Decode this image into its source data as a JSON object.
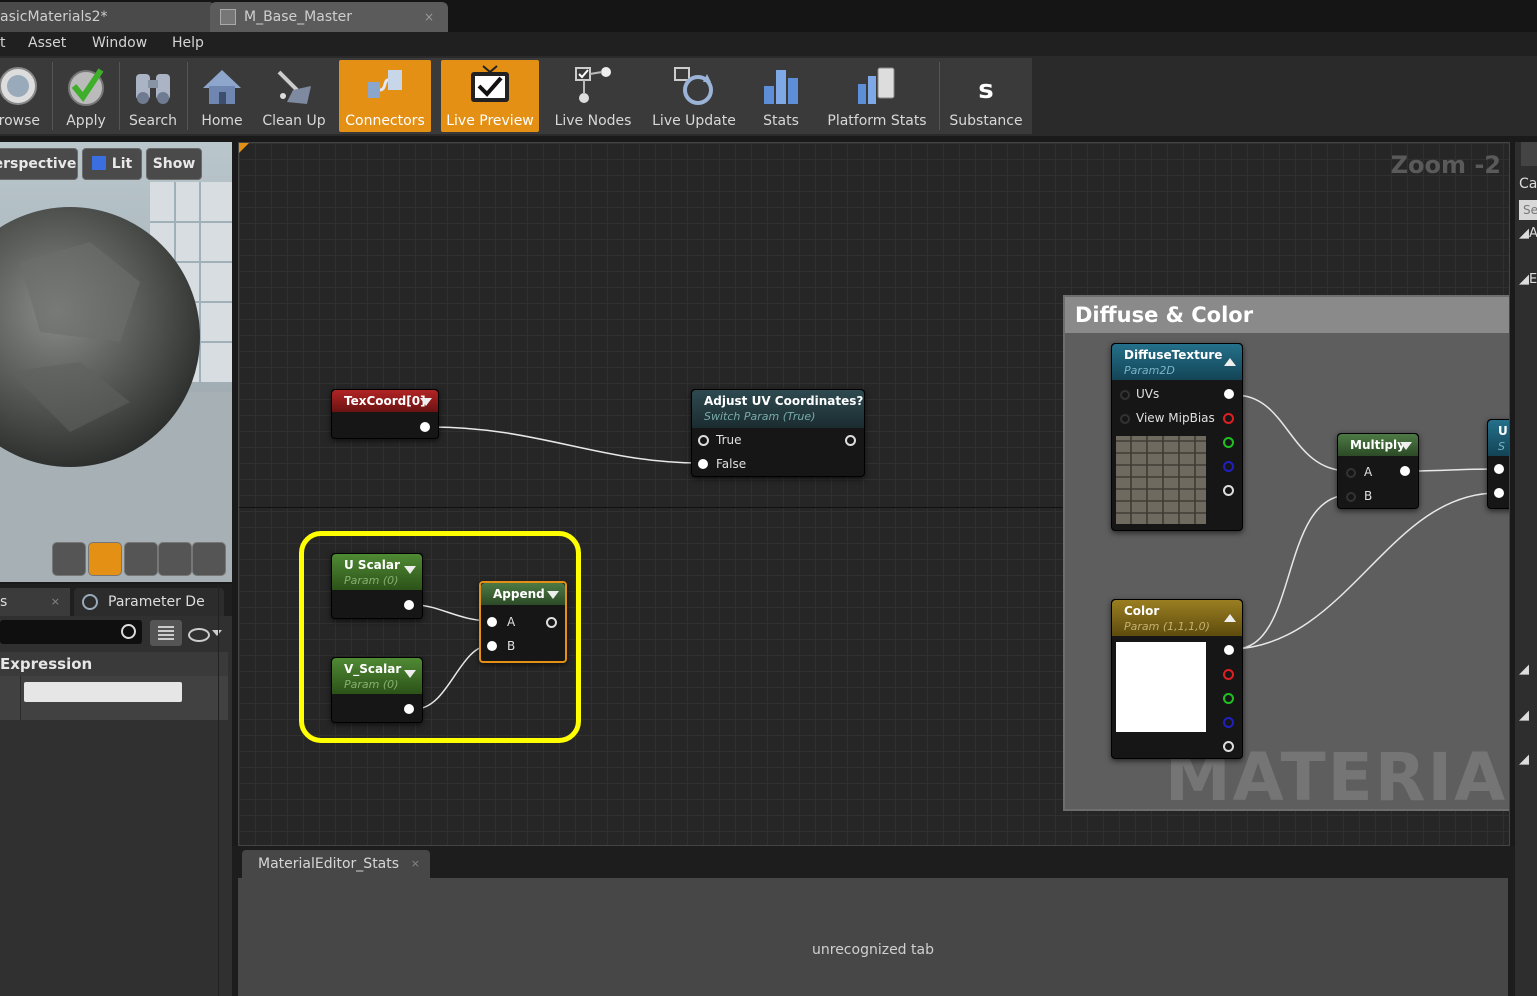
{
  "tabs": [
    {
      "label": "asicMaterials2*"
    },
    {
      "label": "M_Base_Master"
    }
  ],
  "menu": [
    "t",
    "Asset",
    "Window",
    "Help"
  ],
  "toolbar": {
    "buttons": [
      {
        "label": "rowse",
        "icon": "browse-icon"
      },
      {
        "label": "Apply",
        "icon": "apply-checkmark-icon"
      },
      {
        "label": "Search",
        "icon": "search-binoculars-icon"
      },
      {
        "label": "Home",
        "icon": "home-icon"
      },
      {
        "label": "Clean Up",
        "icon": "clean-up-icon"
      },
      {
        "label": "Connectors",
        "icon": "connectors-icon",
        "active": true
      },
      {
        "label": "Live Preview",
        "icon": "live-preview-icon",
        "active": true
      },
      {
        "label": "Live Nodes",
        "icon": "live-nodes-icon"
      },
      {
        "label": "Live Update",
        "icon": "live-update-icon"
      },
      {
        "label": "Stats",
        "icon": "stats-icon"
      },
      {
        "label": "Platform Stats",
        "icon": "platform-stats-icon"
      },
      {
        "label": "Substance",
        "icon": "substance-icon"
      }
    ]
  },
  "viewport": {
    "perspective": "erspective",
    "lit": "Lit",
    "show": "Show"
  },
  "details": {
    "tab_left": "s",
    "tab_param": "Parameter De",
    "expression_label": "Expression"
  },
  "graph": {
    "zoom": "Zoom -2",
    "comment_title": "Diffuse & Color",
    "watermark": "MATERIAL",
    "nodes": {
      "texcoord": {
        "title": "TexCoord[0]"
      },
      "switch": {
        "title": "Adjust UV Coordinates?",
        "subtitle": "Switch Param (True)",
        "pin_true": "True",
        "pin_false": "False"
      },
      "uscalar": {
        "title": "U Scalar",
        "subtitle": "Param (0)"
      },
      "vscalar": {
        "title": "V_Scalar",
        "subtitle": "Param (0)"
      },
      "append": {
        "title": "Append",
        "pin_a": "A",
        "pin_b": "B"
      },
      "diffuse": {
        "title": "DiffuseTexture",
        "subtitle": "Param2D",
        "pin_uvs": "UVs",
        "pin_mip": "View MipBias"
      },
      "color": {
        "title": "Color",
        "subtitle": "Param (1,1,1,0)"
      },
      "multiply": {
        "title": "Multiply",
        "pin_a": "A",
        "pin_b": "B"
      },
      "partial": {
        "title": "U",
        "subtitle": "S"
      }
    },
    "highlight_color": "#ffff00"
  },
  "stats_panel": {
    "tab": "MaterialEditor_Stats",
    "message": "unrecognized tab"
  },
  "right_panel": {
    "label_top": "Ca",
    "search": "Se",
    "cat_a": "A",
    "cat_b": "E"
  },
  "colors": {
    "accent": "#e49015",
    "texcoord_header": "#8c1a1a",
    "param_header": "#3f6a2a",
    "texture_header": "#1e5a70",
    "vector_header": "#7a6418",
    "switch_header": "#233a3e"
  }
}
